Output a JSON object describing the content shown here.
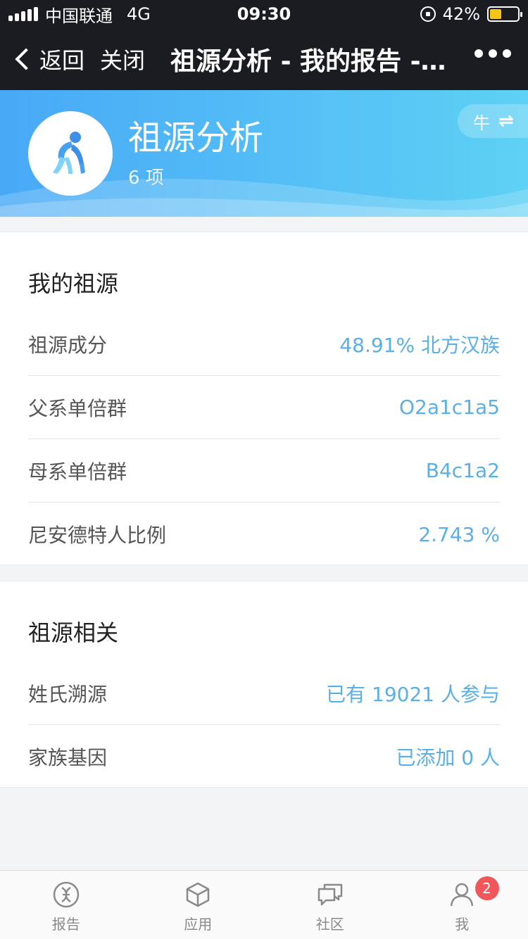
{
  "status_bar": {
    "carrier": "中国联通",
    "network": "4G",
    "time": "09:30",
    "battery": "42%",
    "battery_level": 0.42
  },
  "nav": {
    "back_label": "返回",
    "close_label": "关闭",
    "title": "祖源分析 - 我的报告 - 祖源分析"
  },
  "banner": {
    "title": "祖源分析",
    "count": "6 项",
    "switch_label": "牛",
    "colors": {
      "gradient_start": "#48a9f7",
      "gradient_end": "#5ed1f4"
    }
  },
  "my_ancestry": {
    "title": "我的祖源",
    "rows": [
      {
        "label": "祖源成分",
        "value": "48.91% 北方汉族"
      },
      {
        "label": "父系单倍群",
        "value": "O2a1c1a5"
      },
      {
        "label": "母系单倍群",
        "value": "B4c1a2"
      },
      {
        "label": "尼安德特人比例",
        "value": "2.743 %"
      }
    ]
  },
  "related": {
    "title": "祖源相关",
    "rows": [
      {
        "label": "姓氏溯源",
        "value": "已有 19021 人参与"
      },
      {
        "label": "家族基因",
        "value": "已添加 0 人"
      }
    ]
  },
  "tabs": [
    {
      "label": "报告",
      "icon": "report-dna-icon"
    },
    {
      "label": "应用",
      "icon": "cube-icon"
    },
    {
      "label": "社区",
      "icon": "chat-bubbles-icon"
    },
    {
      "label": "我",
      "icon": "person-icon",
      "badge": "2"
    }
  ],
  "colors": {
    "accent_value": "#5aafe6",
    "badge": "#f0565a",
    "nav_bg": "#1b1c21"
  }
}
